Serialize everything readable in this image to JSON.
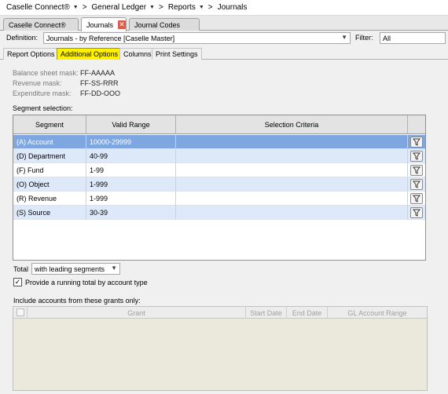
{
  "breadcrumb": [
    {
      "label": "Caselle Connect®",
      "has_menu": true
    },
    {
      "label": "General Ledger",
      "has_menu": true
    },
    {
      "label": "Reports",
      "has_menu": true
    },
    {
      "label": "Journals",
      "has_menu": false
    }
  ],
  "tabs": [
    {
      "label": "Caselle Connect®",
      "active": false
    },
    {
      "label": "Journals",
      "active": true,
      "closable": true
    },
    {
      "label": "Journal Codes",
      "active": false
    }
  ],
  "definition": {
    "label": "Definition:",
    "value": "Journals - by Reference [Caselle Master]",
    "filter_label": "Filter:",
    "filter_value": "All"
  },
  "subtabs": [
    {
      "label": "Report Options",
      "active": false
    },
    {
      "label": "Additional Options",
      "active": true
    },
    {
      "label": "Columns",
      "active": false
    },
    {
      "label": "Print Settings",
      "active": false
    }
  ],
  "masks": [
    {
      "label": "Balance sheet mask:",
      "value": "FF-AAAAA"
    },
    {
      "label": "Revenue mask:",
      "value": "FF-SS-RRR"
    },
    {
      "label": "Expenditure mask:",
      "value": "FF-DD-OOO"
    }
  ],
  "segment_selection": {
    "label": "Segment selection:",
    "columns": [
      "Segment",
      "Valid Range",
      "Selection Criteria"
    ],
    "rows": [
      {
        "segment": "(A) Account",
        "range": "10000-29999",
        "criteria": "",
        "selected": true
      },
      {
        "segment": "(D) Department",
        "range": "40-99",
        "criteria": ""
      },
      {
        "segment": "(F) Fund",
        "range": "1-99",
        "criteria": ""
      },
      {
        "segment": "(O) Object",
        "range": "1-999",
        "criteria": ""
      },
      {
        "segment": "(R) Revenue",
        "range": "1-999",
        "criteria": ""
      },
      {
        "segment": "(S) Source",
        "range": "30-39",
        "criteria": ""
      }
    ]
  },
  "total": {
    "label": "Total",
    "value": "with leading segments"
  },
  "running_total": {
    "label": "Provide a running total by account type",
    "checked": true,
    "check_glyph": "✓"
  },
  "grants": {
    "label": "Include accounts from these grants only:",
    "columns": [
      "Grant",
      "Start Date",
      "End Date",
      "GL Account Range"
    ]
  },
  "colors": {
    "selected_row": "#7ea6e0",
    "alt_row": "#dde8f8",
    "active_subtab": "#fff200"
  },
  "icons": {
    "dropdown": "chevron-down-icon",
    "filter": "filter-icon",
    "close": "close-icon"
  }
}
